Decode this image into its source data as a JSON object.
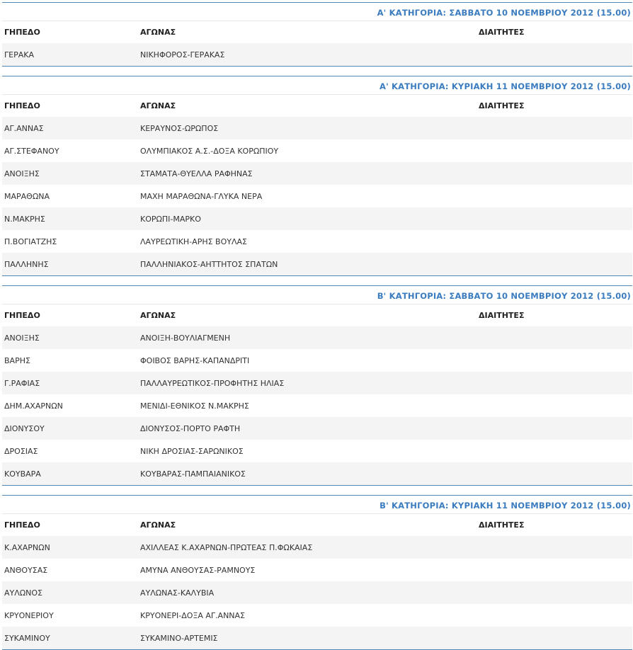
{
  "columns": {
    "ground": "ΓΗΠΕΔΟ",
    "match": "ΑΓΩΝΑΣ",
    "referees": "ΔΙΑΙΤΗΤΕΣ"
  },
  "sections": [
    {
      "title": "Α' ΚΑΤΗΓΟΡΙΑ: ΣΑΒΒΑΤΟ 10 ΝΟΕΜΒΡΙΟΥ 2012 (15.00)",
      "rows": [
        {
          "ground": "ΓΕΡΑΚΑ",
          "match": "ΝΙΚΗΦΟΡΟΣ-ΓΕΡΑΚΑΣ",
          "referees": ""
        }
      ]
    },
    {
      "title": "Α' ΚΑΤΗΓΟΡΙΑ: ΚΥΡΙΑΚΗ 11 ΝΟΕΜΒΡΙΟΥ 2012 (15.00)",
      "rows": [
        {
          "ground": "ΑΓ.ΑΝΝΑΣ",
          "match": "ΚΕΡΑΥΝΟΣ-ΩΡΩΠΟΣ",
          "referees": ""
        },
        {
          "ground": "ΑΓ.ΣΤΕΦΑΝΟΥ",
          "match": "ΟΛΥΜΠΙΑΚΟΣ Α.Σ.-ΔΟΞΑ ΚΟΡΩΠΙΟΥ",
          "referees": ""
        },
        {
          "ground": "ΑΝΟΙΞΗΣ",
          "match": "ΣΤΑΜΑΤΑ-ΘΥΕΛΛΑ ΡΑΦΗΝΑΣ",
          "referees": ""
        },
        {
          "ground": "ΜΑΡΑΘΩΝΑ",
          "match": "ΜΑΧΗ ΜΑΡΑΘΩΝΑ-ΓΛΥΚΑ ΝΕΡΑ",
          "referees": ""
        },
        {
          "ground": "Ν.ΜΑΚΡΗΣ",
          "match": "ΚΟΡΩΠΙ-ΜΑΡΚΟ",
          "referees": ""
        },
        {
          "ground": "Π.ΒΟΓΙΑΤΖΗΣ",
          "match": "ΛΑΥΡΕΩΤΙΚΗ-ΑΡΗΣ ΒΟΥΛΑΣ",
          "referees": ""
        },
        {
          "ground": "ΠΑΛΛΗΝΗΣ",
          "match": "ΠΑΛΛΗΝΙΑΚΟΣ-ΑΗΤΤΗΤΟΣ ΣΠΑΤΩΝ",
          "referees": ""
        }
      ]
    },
    {
      "title": "Β' ΚΑΤΗΓΟΡΙΑ: ΣΑΒΒΑΤΟ 10 ΝΟΕΜΒΡΙΟΥ 2012 (15.00)",
      "rows": [
        {
          "ground": "ΑΝΟΙΞΗΣ",
          "match": "ΑΝΟΙΞΗ-ΒΟΥΛΙΑΓΜΕΝΗ",
          "referees": ""
        },
        {
          "ground": "ΒΑΡΗΣ",
          "match": "ΦΟΙΒΟΣ ΒΑΡΗΣ-ΚΑΠΑΝΔΡΙΤΙ",
          "referees": ""
        },
        {
          "ground": "Γ.ΡΑΦΙΑΣ",
          "match": "ΠΑΛΛΑΥΡΕΩΤΙΚΟΣ-ΠΡΟΦΗΤΗΣ ΗΛΙΑΣ",
          "referees": ""
        },
        {
          "ground": "ΔΗΜ.ΑΧΑΡΝΩΝ",
          "match": "ΜΕΝΙΔΙ-ΕΘΝΙΚΟΣ Ν.ΜΑΚΡΗΣ",
          "referees": ""
        },
        {
          "ground": "ΔΙΟΝΥΣΟΥ",
          "match": "ΔΙΟΝΥΣΟΣ-ΠΟΡΤΟ ΡΑΦΤΗ",
          "referees": ""
        },
        {
          "ground": "ΔΡΟΣΙΑΣ",
          "match": "ΝΙΚΗ ΔΡΟΣΙΑΣ-ΣΑΡΩΝΙΚΟΣ",
          "referees": ""
        },
        {
          "ground": "ΚΟΥΒΑΡΑ",
          "match": "ΚΟΥΒΑΡΑΣ-ΠΑΜΠΑΙΑΝΙΚΟΣ",
          "referees": ""
        }
      ]
    },
    {
      "title": "Β' ΚΑΤΗΓΟΡΙΑ: ΚΥΡΙΑΚΗ 11 ΝΟΕΜΒΡΙΟΥ 2012 (15.00)",
      "rows": [
        {
          "ground": "Κ.ΑΧΑΡΝΩΝ",
          "match": "ΑΧΙΛΛΕΑΣ Κ.ΑΧΑΡΝΩΝ-ΠΡΩΤΕΑΣ Π.ΦΩΚΑΙΑΣ",
          "referees": ""
        },
        {
          "ground": "ΑΝΘΟΥΣΑΣ",
          "match": "ΑΜΥΝΑ ΑΝΘΟΥΣΑΣ-ΡΑΜΝΟΥΣ",
          "referees": ""
        },
        {
          "ground": "ΑΥΛΩΝΟΣ",
          "match": "ΑΥΛΩΝΑΣ-ΚΑΛΥΒΙΑ",
          "referees": ""
        },
        {
          "ground": "ΚΡΥΟΝΕΡΙΟΥ",
          "match": "ΚΡΥΟΝΕΡΙ-ΔΟΞΑ ΑΓ.ΑΝΝΑΣ",
          "referees": ""
        },
        {
          "ground": "ΣΥΚΑΜΙΝΟΥ",
          "match": "ΣΥΚΑΜΙΝΟ-ΑΡΤΕΜΙΣ",
          "referees": ""
        }
      ]
    }
  ]
}
